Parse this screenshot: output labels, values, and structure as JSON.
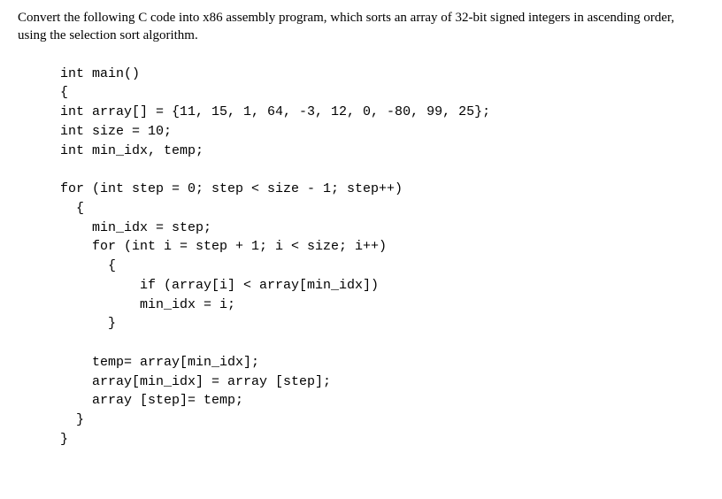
{
  "instruction": "Convert the following C code into x86 assembly program, which sorts an array of 32-bit signed integers in ascending order, using the selection sort algorithm.",
  "code": {
    "l01": "int main()",
    "l02": "{",
    "l03": "int array[] = {11, 15, 1, 64, -3, 12, 0, -80, 99, 25};",
    "l04": "int size = 10;",
    "l05": "int min_idx, temp;",
    "l06": "",
    "l07": "for (int step = 0; step < size - 1; step++)",
    "l08": "  {",
    "l09": "    min_idx = step;",
    "l10": "    for (int i = step + 1; i < size; i++)",
    "l11": "      {",
    "l12": "          if (array[i] < array[min_idx])",
    "l13": "          min_idx = i;",
    "l14": "      }",
    "l15": "",
    "l16": "    temp= array[min_idx];",
    "l17": "    array[min_idx] = array [step];",
    "l18": "    array [step]= temp;",
    "l19": "  }",
    "l20": "}"
  }
}
